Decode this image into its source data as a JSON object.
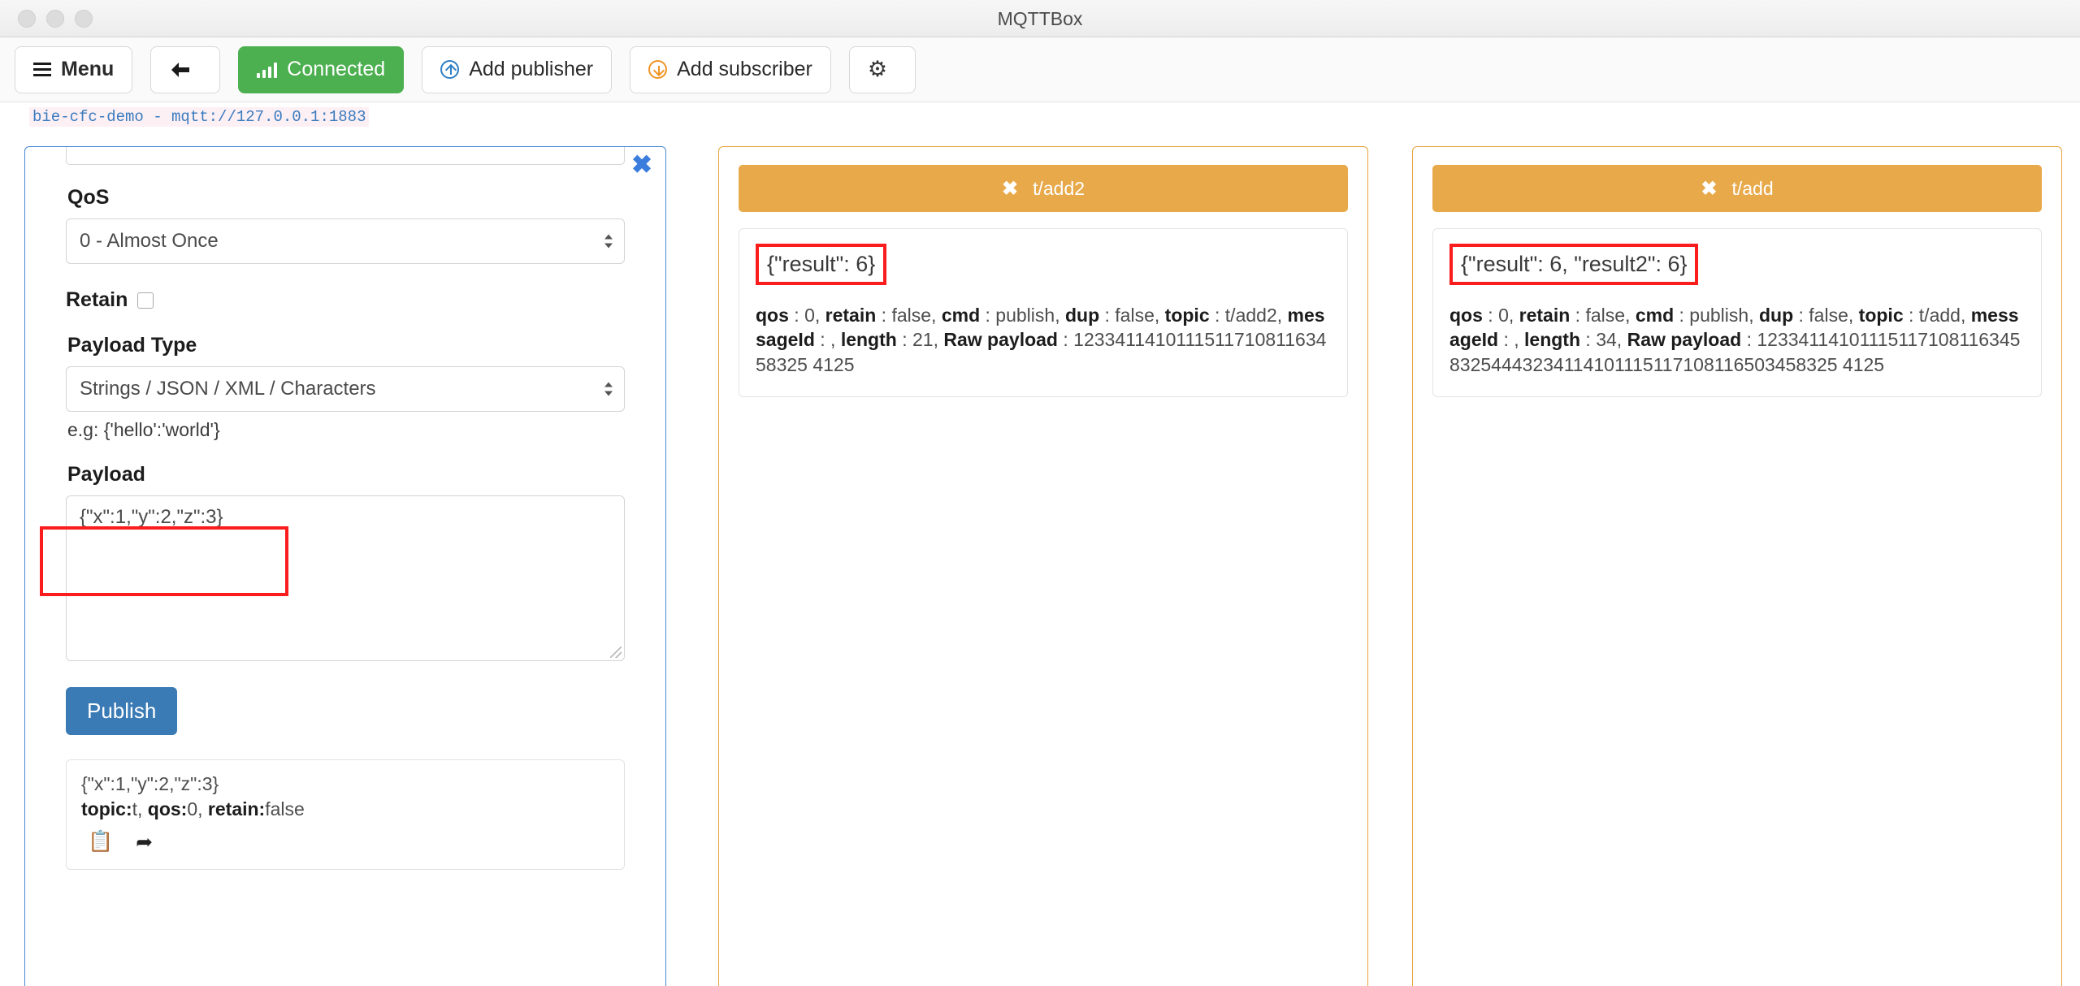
{
  "window": {
    "title": "MQTTBox"
  },
  "toolbar": {
    "menu_label": "Menu",
    "back_label": "",
    "connected_label": "Connected",
    "add_publisher_label": "Add publisher",
    "add_subscriber_label": "Add subscriber",
    "settings_label": ""
  },
  "connection": {
    "label": "bie-cfc-demo - mqtt://127.0.0.1:1883"
  },
  "publisher": {
    "close_label": "✖",
    "qos": {
      "label": "QoS",
      "value": "0 - Almost Once"
    },
    "retain": {
      "label": "Retain",
      "checked": false
    },
    "payload_type": {
      "label": "Payload Type",
      "value": "Strings / JSON / XML / Characters",
      "hint": "e.g: {'hello':'world'}"
    },
    "payload": {
      "label": "Payload",
      "value": "{\"x\":1,\"y\":2,\"z\":3}"
    },
    "publish_button": "Publish",
    "history": {
      "payload": "{\"x\":1,\"y\":2,\"z\":3}",
      "meta_topic_key": "topic:",
      "meta_topic_val": "t, ",
      "meta_qos_key": "qos:",
      "meta_qos_val": "0, ",
      "meta_retain_key": "retain:",
      "meta_retain_val": "false",
      "copy_icon": "📋",
      "forward_icon": "➦"
    }
  },
  "subscribers": [
    {
      "close_icon": "✖",
      "topic": "t/add2",
      "payload": "{\"result\": 6}",
      "meta": {
        "qos_key": "qos",
        "qos_val": "0",
        "retain_key": "retain",
        "retain_val": "false",
        "cmd_key": "cmd",
        "cmd_val": "publish",
        "dup_key": "dup",
        "dup_val": "false",
        "topic_key": "topic",
        "topic_val": "t/add2",
        "messageid_key": "messageId",
        "messageid_val": "",
        "length_key": "length",
        "length_val": "21",
        "raw_key": "Raw payload",
        "raw_val": "123341141011151171081163458325 4125"
      }
    },
    {
      "close_icon": "✖",
      "topic": "t/add",
      "payload": "{\"result\": 6, \"result2\": 6}",
      "meta": {
        "qos_key": "qos",
        "qos_val": "0",
        "retain_key": "retain",
        "retain_val": "false",
        "cmd_key": "cmd",
        "cmd_val": "publish",
        "dup_key": "dup",
        "dup_val": "false",
        "topic_key": "topic",
        "topic_val": "t/add",
        "messageid_key": "messageId",
        "messageid_val": "",
        "length_key": "length",
        "length_val": "34",
        "raw_key": "Raw payload",
        "raw_val": "1233411410111511710811634583254443234114101115117108116503458325 4125"
      }
    }
  ],
  "colors": {
    "connected_green": "#4cb050",
    "publisher_blue": "#4b89d4",
    "subscriber_orange": "#e8a33d",
    "subscriber_header": "#e8a94a",
    "highlight_red": "#fb1d1d",
    "publish_button_blue": "#3a7ab5"
  }
}
